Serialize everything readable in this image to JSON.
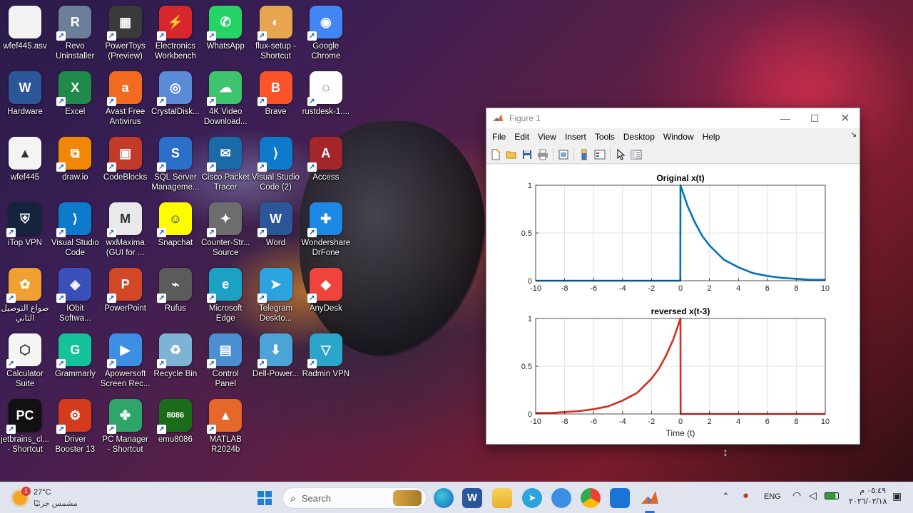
{
  "desktop": {
    "icons": [
      {
        "label": "wfef445.asv",
        "icon": "document-icon",
        "color": "#f2f2f2",
        "glyph": ""
      },
      {
        "label": "Revo\nUninstaller",
        "icon": "revo-uninstaller-icon",
        "color": "#6b7f9a",
        "glyph": "R"
      },
      {
        "label": "PowerToys\n(Preview)",
        "icon": "powertoys-icon",
        "color": "#3a3a3a",
        "glyph": "▦"
      },
      {
        "label": "Electronics\nWorkbench",
        "icon": "electronics-workbench-icon",
        "color": "#d8262d",
        "glyph": "⚡"
      },
      {
        "label": "WhatsApp",
        "icon": "whatsapp-icon",
        "color": "#25d366",
        "glyph": "✆"
      },
      {
        "label": "flux-setup -\nShortcut",
        "icon": "flux-icon",
        "color": "#e8a550",
        "glyph": "◐"
      },
      {
        "label": "Google\nChrome",
        "icon": "chrome-icon",
        "color": "#4285f4",
        "glyph": "◉"
      },
      {
        "label": "Hardware",
        "icon": "word-doc-icon",
        "color": "#2b579a",
        "glyph": "W"
      },
      {
        "label": "Excel",
        "icon": "excel-icon",
        "color": "#1f8a4c",
        "glyph": "X"
      },
      {
        "label": "Avast Free\nAntivirus",
        "icon": "avast-icon",
        "color": "#f26b21",
        "glyph": "a"
      },
      {
        "label": "CrystalDisk...",
        "icon": "crystaldisk-icon",
        "color": "#5b8bd6",
        "glyph": "◎"
      },
      {
        "label": "4K Video\nDownload...",
        "icon": "4k-video-icon",
        "color": "#3ec46d",
        "glyph": "☁"
      },
      {
        "label": "Brave",
        "icon": "brave-icon",
        "color": "#fb542b",
        "glyph": "B"
      },
      {
        "label": "rustdesk-1....",
        "icon": "rustdesk-icon",
        "color": "#ffffff",
        "glyph": "◌"
      },
      {
        "label": "wfef445",
        "icon": "matlab-file-icon",
        "color": "#f4f4f4",
        "glyph": "▲"
      },
      {
        "label": "draw.io",
        "icon": "drawio-icon",
        "color": "#f08705",
        "glyph": "⧉"
      },
      {
        "label": "CodeBlocks",
        "icon": "codeblocks-icon",
        "color": "#c23b2a",
        "glyph": "▣"
      },
      {
        "label": "SQL Server\nManageme...",
        "icon": "sql-server-icon",
        "color": "#2c6fc9",
        "glyph": "S"
      },
      {
        "label": "Cisco Packet\nTracer",
        "icon": "packet-tracer-icon",
        "color": "#1b6aa8",
        "glyph": "✉"
      },
      {
        "label": "Visual Studio\nCode (2)",
        "icon": "vscode-icon",
        "color": "#0e7acc",
        "glyph": "⟩"
      },
      {
        "label": "Access",
        "icon": "access-icon",
        "color": "#a4262c",
        "glyph": "A"
      },
      {
        "label": "iTop VPN",
        "icon": "itop-vpn-icon",
        "color": "#14243c",
        "glyph": "⛨"
      },
      {
        "label": "Visual Studio\nCode",
        "icon": "vscode-icon",
        "color": "#0e7acc",
        "glyph": "⟩"
      },
      {
        "label": "wxMaxima\n(GUI for ...",
        "icon": "wxmaxima-icon",
        "color": "#e9e9e9",
        "glyph": "M"
      },
      {
        "label": "Snapchat",
        "icon": "snapchat-icon",
        "color": "#fffc00",
        "glyph": "☺"
      },
      {
        "label": "Counter-Str...\nSource",
        "icon": "counter-strike-icon",
        "color": "#6d6d6d",
        "glyph": "✦"
      },
      {
        "label": "Word",
        "icon": "word-icon",
        "color": "#2b579a",
        "glyph": "W"
      },
      {
        "label": "Wondershare\nDrFone",
        "icon": "drfone-icon",
        "color": "#1e88e5",
        "glyph": "✚"
      },
      {
        "label": "صواع التوصيل\nالتاني",
        "icon": "arabic-app-icon",
        "color": "#f0a030",
        "glyph": "✿"
      },
      {
        "label": "IObit\nSoftwa...",
        "icon": "iobit-icon",
        "color": "#3a4fb8",
        "glyph": "◈"
      },
      {
        "label": "PowerPoint",
        "icon": "powerpoint-icon",
        "color": "#d24726",
        "glyph": "P"
      },
      {
        "label": "Rufus",
        "icon": "rufus-icon",
        "color": "#5b5b5b",
        "glyph": "⌁"
      },
      {
        "label": "Microsoft\nEdge",
        "icon": "edge-icon",
        "color": "#1ba1c4",
        "glyph": "e"
      },
      {
        "label": "Telegram\nDeskto...",
        "icon": "telegram-icon",
        "color": "#2aa3df",
        "glyph": "➤"
      },
      {
        "label": "AnyDesk",
        "icon": "anydesk-icon",
        "color": "#ef443b",
        "glyph": "◆"
      },
      {
        "label": "Calculator\nSuite",
        "icon": "geogebra-icon",
        "color": "#f5f5f5",
        "glyph": "⬡"
      },
      {
        "label": "Grammarly",
        "icon": "grammarly-icon",
        "color": "#15c39a",
        "glyph": "G"
      },
      {
        "label": "Apowersoft\nScreen Rec...",
        "icon": "apowersoft-icon",
        "color": "#3d8fe6",
        "glyph": "▶"
      },
      {
        "label": "Recycle Bin",
        "icon": "recycle-bin-icon",
        "color": "#7fb3d6",
        "glyph": "♻"
      },
      {
        "label": "Control\nPanel",
        "icon": "control-panel-icon",
        "color": "#4a8fd0",
        "glyph": "▤"
      },
      {
        "label": "Dell-Power...",
        "icon": "dell-power-icon",
        "color": "#4ca3d8",
        "glyph": "⬇"
      },
      {
        "label": "Radmin VPN",
        "icon": "radmin-vpn-icon",
        "color": "#2ba5c9",
        "glyph": "▽"
      },
      {
        "label": "jetbrains_cl...\n- Shortcut",
        "icon": "jetbrains-icon",
        "color": "#111111",
        "glyph": "PC"
      },
      {
        "label": "Driver\nBooster 13",
        "icon": "driver-booster-icon",
        "color": "#d43a1c",
        "glyph": "⚙"
      },
      {
        "label": "PC Manager\n- Shortcut",
        "icon": "pc-manager-icon",
        "color": "#2ea66a",
        "glyph": "✤"
      },
      {
        "label": "emu8086",
        "icon": "emu8086-icon",
        "color": "#1a6b1a",
        "glyph": "8086"
      },
      {
        "label": "MATLAB\nR2024b",
        "icon": "matlab-icon",
        "color": "#e5672a",
        "glyph": "▲"
      }
    ]
  },
  "figure_window": {
    "title": "Figure 1",
    "menu": [
      "File",
      "Edit",
      "View",
      "Insert",
      "Tools",
      "Desktop",
      "Window",
      "Help"
    ],
    "toolbar": [
      "new-figure-icon",
      "open-file-icon",
      "save-icon",
      "print-icon",
      "link-plot-icon",
      "insert-colorbar-icon",
      "insert-legend-icon",
      "select-pointer-icon",
      "property-inspector-icon"
    ]
  },
  "chart_data": [
    {
      "type": "line",
      "title": "Original x(t)",
      "xlabel": "",
      "ylabel": "",
      "xlim": [
        -10,
        10
      ],
      "ylim": [
        0,
        1
      ],
      "xticks": [
        -10,
        -8,
        -6,
        -4,
        -2,
        0,
        2,
        4,
        6,
        8,
        10
      ],
      "yticks": [
        0,
        0.5,
        1
      ],
      "grid": true,
      "color": "#0072bd",
      "x": [
        -10,
        -0.01,
        0,
        0.5,
        1,
        1.5,
        2,
        3,
        4,
        5,
        6,
        7,
        8,
        9,
        10
      ],
      "y": [
        0,
        0,
        1,
        0.78,
        0.61,
        0.47,
        0.37,
        0.22,
        0.14,
        0.08,
        0.05,
        0.03,
        0.02,
        0.01,
        0.01
      ]
    },
    {
      "type": "line",
      "title": "reversed x(t-3)",
      "xlabel": "Time (t)",
      "ylabel": "",
      "xlim": [
        -10,
        10
      ],
      "ylim": [
        0,
        1
      ],
      "xticks": [
        -10,
        -8,
        -6,
        -4,
        -2,
        0,
        2,
        4,
        6,
        8,
        10
      ],
      "yticks": [
        0,
        0.5,
        1
      ],
      "grid": true,
      "color": "#d62b1f",
      "x": [
        -10,
        -9,
        -8,
        -7,
        -6,
        -5,
        -4,
        -3,
        -2,
        -1.5,
        -1,
        -0.5,
        0,
        0.01,
        10
      ],
      "y": [
        0.01,
        0.01,
        0.02,
        0.03,
        0.05,
        0.08,
        0.14,
        0.22,
        0.37,
        0.47,
        0.61,
        0.78,
        1,
        0,
        0
      ]
    }
  ],
  "taskbar": {
    "weather": {
      "temp": "27°C",
      "desc": "مشمس جزئيًا",
      "badge": "1"
    },
    "search_placeholder": "Search",
    "language": "ENG",
    "time": "٠٥:٤٩ م",
    "date": "٢٠٢٦/٠٢/١٨"
  }
}
